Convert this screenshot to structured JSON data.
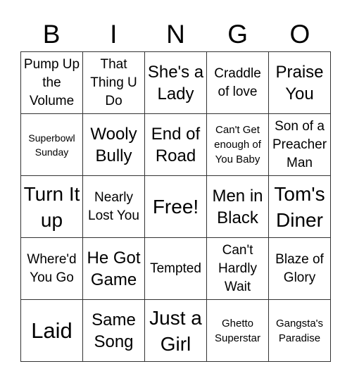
{
  "header": [
    "B",
    "I",
    "N",
    "G",
    "O"
  ],
  "cells": [
    {
      "text": "Pump Up the Volume",
      "size": "md"
    },
    {
      "text": "That Thing U Do",
      "size": "md"
    },
    {
      "text": "She's a Lady",
      "size": "xl"
    },
    {
      "text": "Craddle of love",
      "size": "md"
    },
    {
      "text": "Praise You",
      "size": "xl"
    },
    {
      "text": "Superbowl Sunday",
      "size": "xs"
    },
    {
      "text": "Wooly Bully",
      "size": "xl"
    },
    {
      "text": "End of Road",
      "size": "xl"
    },
    {
      "text": "Can't Get enough of You Baby",
      "size": "sm"
    },
    {
      "text": "Son of a Preacher Man",
      "size": "md"
    },
    {
      "text": "Turn It up",
      "size": "xxl"
    },
    {
      "text": "Nearly Lost You",
      "size": "md"
    },
    {
      "text": "Free!",
      "size": "xxl"
    },
    {
      "text": "Men in Black",
      "size": "xl"
    },
    {
      "text": "Tom's Diner",
      "size": "xxl"
    },
    {
      "text": "Where'd You Go",
      "size": "md"
    },
    {
      "text": "He Got Game",
      "size": "xl"
    },
    {
      "text": "Tempted",
      "size": "md"
    },
    {
      "text": "Can't Hardly Wait",
      "size": "md"
    },
    {
      "text": "Blaze of Glory",
      "size": "md"
    },
    {
      "text": "Laid",
      "size": "huge"
    },
    {
      "text": "Same Song",
      "size": "xl"
    },
    {
      "text": "Just a Girl",
      "size": "xxl"
    },
    {
      "text": "Ghetto Superstar",
      "size": "sm"
    },
    {
      "text": "Gangsta's Paradise",
      "size": "sm"
    }
  ]
}
